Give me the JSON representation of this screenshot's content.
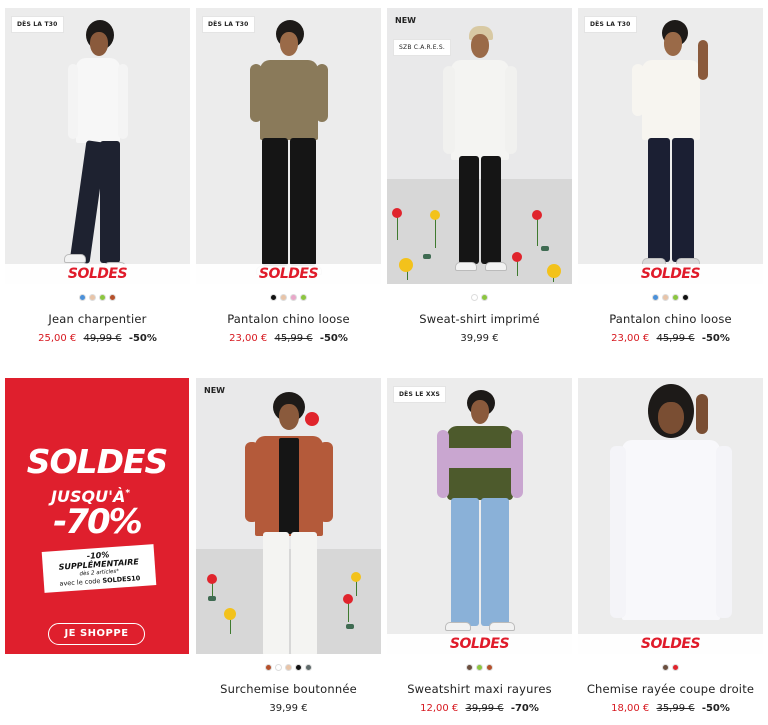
{
  "products": [
    {
      "tag": "DÈS LA T30",
      "sale_banner": "SOLDES",
      "swatches": [
        "#4a90d9",
        "#e8c4a8",
        "#8cc63f",
        "#b5502b"
      ],
      "name": "Jean charpentier",
      "price_sale": "25,00 €",
      "price_old": "49,99 €",
      "discount": "-50%"
    },
    {
      "tag": "DÈS LA T30",
      "sale_banner": "SOLDES",
      "swatches": [
        "#111111",
        "#e8c4a8",
        "#e9a7c9",
        "#8cc63f"
      ],
      "name": "Pantalon chino loose",
      "price_sale": "23,00 €",
      "price_old": "45,99 €",
      "discount": "-50%"
    },
    {
      "tag": "NEW",
      "tag2": "SZB C.A.R.E.S.",
      "swatches": [
        "#ffffff",
        "#8cc63f"
      ],
      "name": "Sweat-shirt imprimé",
      "price": "39,99 €"
    },
    {
      "tag": "DÈS LA T30",
      "sale_banner": "SOLDES",
      "swatches": [
        "#4a90d9",
        "#e8c4a8",
        "#8cc63f",
        "#111111"
      ],
      "name": "Pantalon chino loose",
      "price_sale": "23,00 €",
      "price_old": "45,99 €",
      "discount": "-50%"
    },
    {
      "tag": "NEW",
      "swatches": [
        "#b5502b",
        "#ffffff",
        "#e8c4a8",
        "#111111",
        "#5f6b6b"
      ],
      "name": "Surchemise boutonnée",
      "price": "39,99 €"
    },
    {
      "tag": "DÈS LE XXS",
      "sale_banner": "SOLDES",
      "swatches": [
        "#6b4f3f",
        "#8cc63f",
        "#b5502b"
      ],
      "name": "Sweatshirt maxi rayures",
      "price_sale": "12,00 €",
      "price_old": "39,99 €",
      "discount": "-70%"
    },
    {
      "sale_banner": "SOLDES",
      "swatches": [
        "#6b4f3f",
        "#e0242c"
      ],
      "name": "Chemise rayée coupe droite",
      "price_sale": "18,00 €",
      "price_old": "35,99 €",
      "discount": "-50%"
    }
  ],
  "promo": {
    "title": "SOLDES",
    "line1": "JUSQU'À",
    "asterisk": "*",
    "percent": "-70%",
    "extra": "-10% SUPPLÉMENTAIRE",
    "extra_sub": "dès 2 articles*",
    "code_prefix": "avec le code",
    "code": "SOLDES10",
    "cta": "JE SHOPPE",
    "color": "#df1f2d"
  },
  "colors": {
    "sale_price": "#d71920",
    "sale_banner": "#e01b2a"
  }
}
